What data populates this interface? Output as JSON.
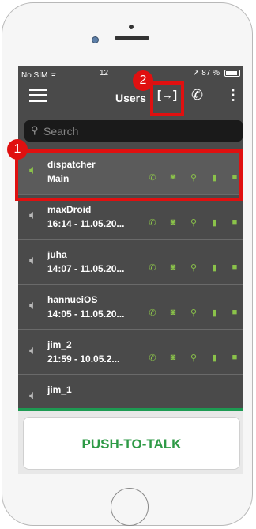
{
  "status_bar": {
    "carrier": "No SIM",
    "time": "12",
    "battery": "87 %"
  },
  "navbar": {
    "title": "Users",
    "exit_icon": "[→]",
    "phone_icon": "phone-icon",
    "more_icon": "more-icon"
  },
  "search": {
    "placeholder": "Search"
  },
  "users": [
    {
      "name": "dispatcher",
      "sub": "Main",
      "active": true
    },
    {
      "name": "maxDroid",
      "sub": "16:14 - 11.05.20...",
      "active": false
    },
    {
      "name": "juha",
      "sub": "14:07 - 11.05.20...",
      "active": false
    },
    {
      "name": "hannueiOS",
      "sub": "14:05 - 11.05.20...",
      "active": false
    },
    {
      "name": "jim_2",
      "sub": "21:59 - 10.05.2...",
      "active": false
    },
    {
      "name": "jim_1",
      "sub": "",
      "active": false
    }
  ],
  "ptt": {
    "label": "PUSH-TO-TALK"
  },
  "annotations": [
    {
      "number": "1"
    },
    {
      "number": "2"
    }
  ],
  "colors": {
    "accent_green": "#8bc34a",
    "ptt_green": "#2e9a46",
    "highlight_red": "#e01010"
  }
}
